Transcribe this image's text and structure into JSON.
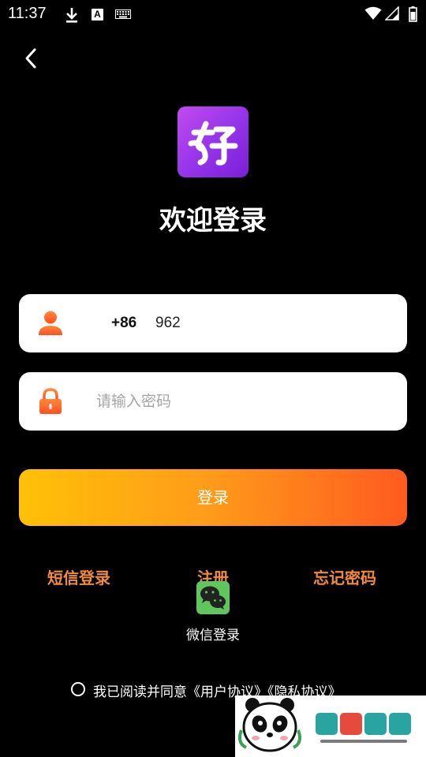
{
  "status_bar": {
    "time": "11:37",
    "icons": [
      "download-icon",
      "font-a-icon",
      "keyboard-icon",
      "wifi-icon",
      "signal-icon",
      "battery-icon"
    ],
    "a_badge": "A"
  },
  "header": {
    "back_icon": "chevron-left-icon"
  },
  "app_icon": {
    "colors": [
      "#c24bf0",
      "#9333ea",
      "#7c1fd8"
    ]
  },
  "title": "欢迎登录",
  "phone_field": {
    "country_code": "+86",
    "value": "962",
    "icon": "user-icon"
  },
  "password_field": {
    "placeholder": "请输入密码",
    "icon": "lock-icon"
  },
  "login_button": {
    "label": "登录",
    "gradient": [
      "#ffc107",
      "#ff9a1a",
      "#ff5a1f"
    ]
  },
  "links": {
    "sms_login": "短信登录",
    "register": "注册",
    "forgot_password": "忘记密码",
    "color": "#f08a3c"
  },
  "wechat": {
    "label": "微信登录",
    "icon": "wechat-icon",
    "color": "#5ec65a"
  },
  "agreement": {
    "text": "我已阅读并同意《用户协议》《隐私协议》"
  },
  "accent_color": "#ff6a1a"
}
